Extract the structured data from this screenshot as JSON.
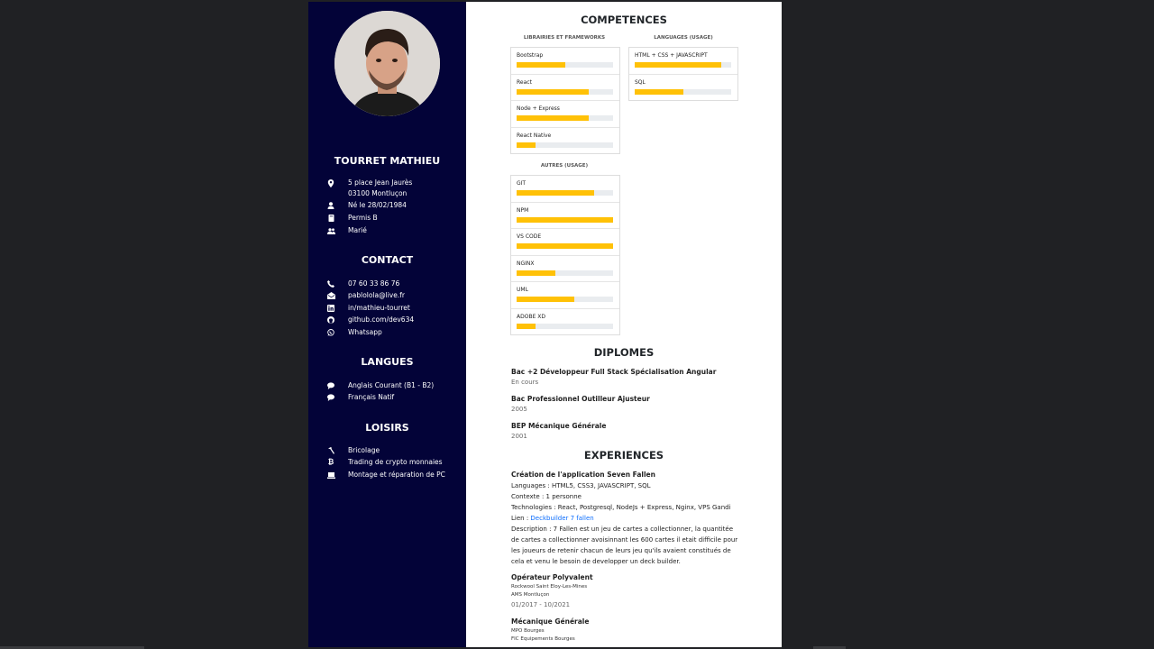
{
  "profile": {
    "name": "TOURRET MATHIEU",
    "details": [
      {
        "icon": "location-pin-icon",
        "lines": [
          "5 place Jean Jaurès",
          "03100 Montluçon"
        ]
      },
      {
        "icon": "person-icon",
        "lines": [
          "Né le 28/02/1984"
        ]
      },
      {
        "icon": "id-card-icon",
        "lines": [
          "Permis B"
        ]
      },
      {
        "icon": "people-icon",
        "lines": [
          "Marié"
        ]
      }
    ]
  },
  "contact": {
    "title": "CONTACT",
    "items": [
      {
        "icon": "phone-icon",
        "text": "07 60 33 86 76"
      },
      {
        "icon": "mail-icon",
        "text": "pablolola@live.fr"
      },
      {
        "icon": "linkedin-icon",
        "text": "in/mathieu-tourret"
      },
      {
        "icon": "github-icon",
        "text": "github.com/dev634"
      },
      {
        "icon": "whatsapp-icon",
        "text": "Whatsapp"
      }
    ]
  },
  "langues": {
    "title": "LANGUES",
    "items": [
      {
        "icon": "speech-bubble-icon",
        "text": "Anglais Courant (B1 - B2)"
      },
      {
        "icon": "speech-bubble-icon",
        "text": "Français Natif"
      }
    ]
  },
  "loisirs": {
    "title": "LOISIRS",
    "items": [
      {
        "icon": "hammer-icon",
        "text": "Bricolage"
      },
      {
        "icon": "bitcoin-icon",
        "text": "Trading de crypto monnaies"
      },
      {
        "icon": "laptop-icon",
        "text": "Montage et réparation de PC"
      }
    ]
  },
  "competences": {
    "title": "COMPETENCES",
    "accent_color": "#ffc107",
    "groups": [
      {
        "title": "LIBRAIRIES ET FRAMEWORKS",
        "skills": [
          {
            "name": "Bootstrap",
            "level": 0.5
          },
          {
            "name": "React",
            "level": 0.75
          },
          {
            "name": "Node + Express",
            "level": 0.75
          },
          {
            "name": "React Native",
            "level": 0.2
          }
        ]
      },
      {
        "title": "LANGUAGES (USAGE)",
        "skills": [
          {
            "name": "HTML + CSS + JAVASCRIPT",
            "level": 0.9
          },
          {
            "name": "SQL",
            "level": 0.5
          }
        ]
      },
      {
        "title": "AUTRES (USAGE)",
        "skills": [
          {
            "name": "GIT",
            "level": 0.8
          },
          {
            "name": "NPM",
            "level": 1.0
          },
          {
            "name": "VS CODE",
            "level": 1.0
          },
          {
            "name": "NGINX",
            "level": 0.4
          },
          {
            "name": "UML",
            "level": 0.6
          },
          {
            "name": "ADOBE XD",
            "level": 0.2
          }
        ]
      }
    ]
  },
  "diplomes": {
    "title": "DIPLOMES",
    "items": [
      {
        "title": "Bac +2 Développeur Full Stack Spécialisation Angular",
        "sub": "En cours"
      },
      {
        "title": "Bac Professionnel Outilleur Ajusteur",
        "sub": "2005"
      },
      {
        "title": "BEP Mécanique Générale",
        "sub": "2001"
      }
    ]
  },
  "experiences": {
    "title": "EXPERIENCES",
    "exp1": {
      "title": "Création de l'application Seven Fallen",
      "languages": "Languages : HTML5, CSS3, JAVASCRIPT, SQL",
      "context": "Contexte : 1 personne",
      "technologies": "Technologies : React, Postgresql, NodeJs + Express, Nginx, VPS Gandi",
      "link_label": "Lien : ",
      "link_text": "Deckbuilder 7 fallen",
      "desc": [
        "Description : 7 Fallen est un jeu de cartes a collectionner, la quantitée",
        "de cartes a collectionner avoisinnant les 600 cartes il etait difficile pour",
        "les joueurs de retenir chacun de leurs jeu qu'ils avaient constitués de",
        "cela et venu le besoin de developper un deck builder."
      ]
    },
    "exp2": {
      "title": "Opérateur Polyvalent",
      "company": "Rockwool Saint Eloy-Les-Mines",
      "agency": "AMS Montluçon",
      "dates": "01/2017 - 10/2021"
    },
    "exp3": {
      "title": "Mécanique Générale",
      "company": "MPO Bourges",
      "agency": "FIC Equipements Bourges"
    }
  }
}
